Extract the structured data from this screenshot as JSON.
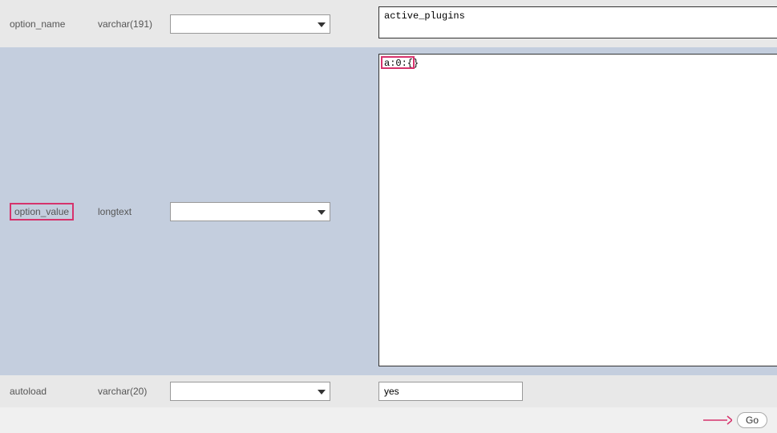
{
  "rows": {
    "option_name": {
      "label": "option_name",
      "type": "varchar(191)",
      "select_value": "",
      "value": "active_plugins"
    },
    "option_value": {
      "label": "option_value",
      "type": "longtext",
      "select_value": "",
      "value": "a:0:{}"
    },
    "autoload": {
      "label": "autoload",
      "type": "varchar(20)",
      "select_value": "",
      "value": "yes"
    }
  },
  "footer": {
    "go_label": "Go"
  },
  "highlights": {
    "option_value_label_highlighted": true,
    "option_value_text_highlighted": true
  },
  "colors": {
    "highlight": "#d6336c",
    "row_light": "#e8e8e8",
    "row_blue": "#c4cede"
  }
}
